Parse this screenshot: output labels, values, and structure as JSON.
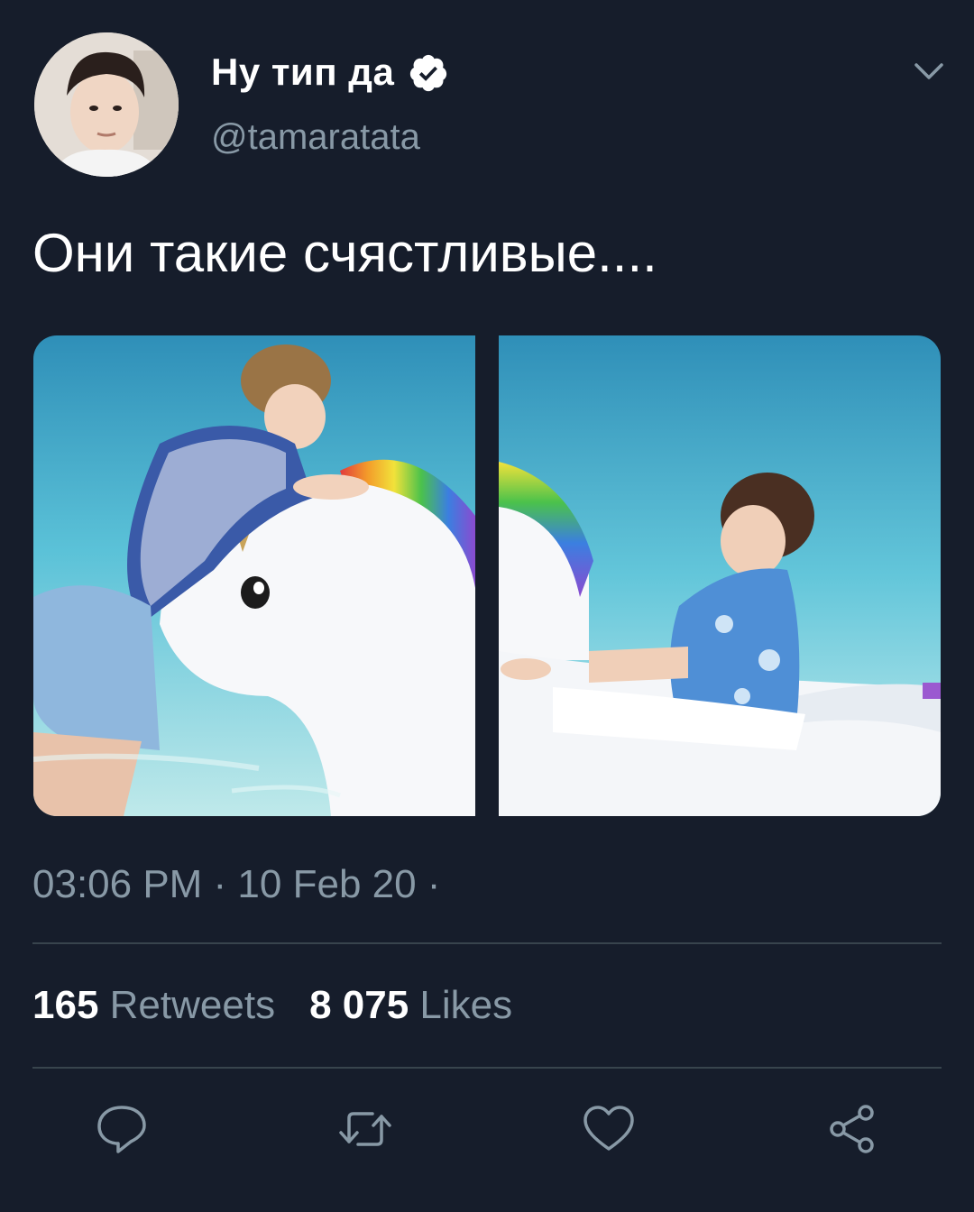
{
  "author": {
    "name": "Ну тип да",
    "handle": "@tamaratata",
    "verified_icon": "verified-badge-icon",
    "avatar_icon": "profile-avatar"
  },
  "tweet": {
    "text": "Они такие счястливые....",
    "timestamp": "03:06 PM · 10 Feb 20 ·",
    "media": [
      {
        "name": "photo-left"
      },
      {
        "name": "photo-right"
      }
    ]
  },
  "stats": {
    "retweets_count": "165",
    "retweets_label": "Retweets",
    "likes_count": "8 075",
    "likes_label": "Likes"
  },
  "actions": [
    {
      "icon": "reply-icon"
    },
    {
      "icon": "retweet-icon"
    },
    {
      "icon": "like-icon"
    },
    {
      "icon": "share-icon"
    }
  ],
  "colors": {
    "background": "#161d2b",
    "secondary_text": "#8899a6",
    "divider": "#38444d",
    "verified": "#ffffff"
  }
}
